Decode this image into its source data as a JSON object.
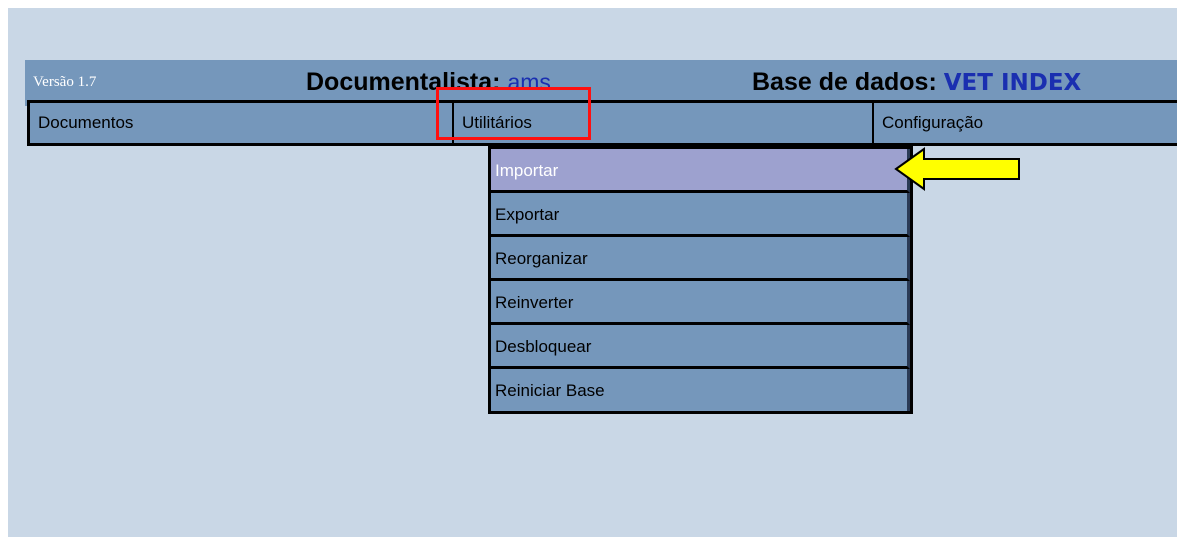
{
  "header": {
    "version": "Versão 1.7",
    "documentalista_label": "Documentalista:",
    "documentalista_user": "ams",
    "base_label": "Base de dados:",
    "base_name": "VET INDEX"
  },
  "menubar": {
    "items": [
      {
        "label": "Documentos"
      },
      {
        "label": "Utilitários"
      },
      {
        "label": "Configuração"
      }
    ]
  },
  "dropdown": {
    "items": [
      {
        "label": "Importar",
        "active": true
      },
      {
        "label": "Exportar"
      },
      {
        "label": "Reorganizar"
      },
      {
        "label": "Reinverter"
      },
      {
        "label": "Desbloquear"
      },
      {
        "label": "Reiniciar Base"
      }
    ]
  },
  "colors": {
    "background": "#c9d7e6",
    "bar": "#7597bb",
    "active_item": "#9da1cf",
    "highlight_box": "#ff1010",
    "arrow": "#ffff00",
    "link_text": "#1a2fb0"
  },
  "icons": {
    "pointer": "yellow-arrow-icon"
  }
}
